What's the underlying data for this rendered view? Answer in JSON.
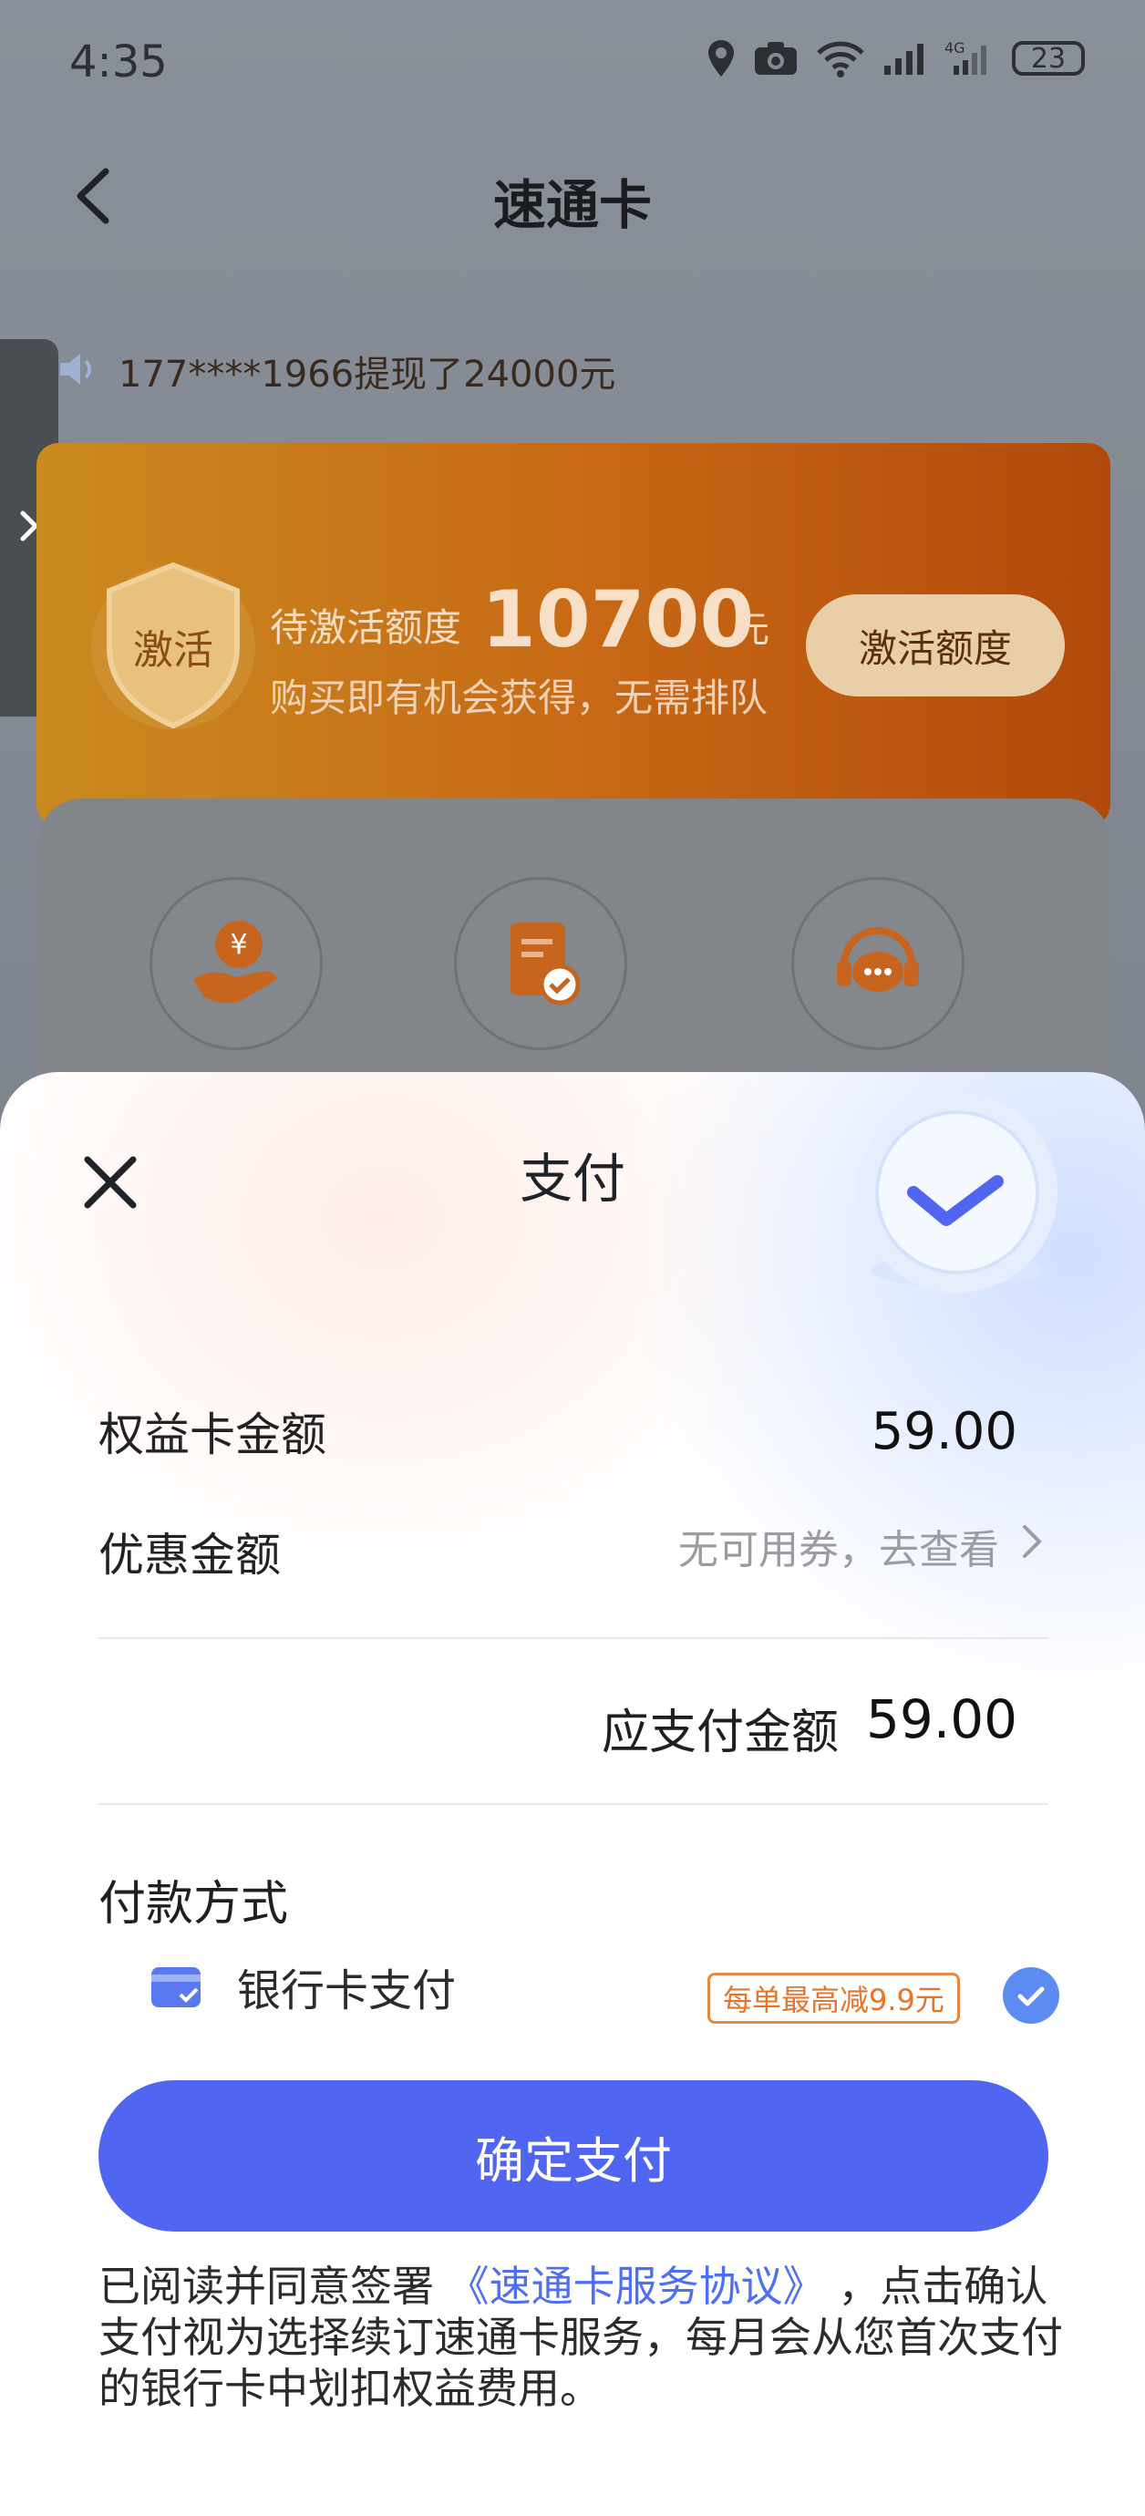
{
  "status_bar": {
    "time": "4:35",
    "battery": "23"
  },
  "header": {
    "title": "速通卡"
  },
  "ticker": {
    "text": "177****1966提现了24000元"
  },
  "promo": {
    "badge": "激活",
    "label": "待激活额度",
    "amount": "10700",
    "unit": "元",
    "subtitle": "购买即有机会获得，无需排队",
    "button": "激活额度"
  },
  "sheet": {
    "title": "支付",
    "card_amount_label": "权益卡金额",
    "card_amount_value": "59.00",
    "discount_label": "优惠金额",
    "discount_hint": "无可用券，去查看",
    "total_label": "应支付金额",
    "total_value": "59.00",
    "payment_method_title": "付款方式",
    "payment_option": {
      "label": "银行卡支付",
      "tag": "每单最高减9.9元",
      "selected": true
    },
    "confirm_button": "确定支付",
    "agreement": {
      "prefix": "已阅读并同意签署",
      "link": "《速通卡服务协议》",
      "suffix": "，点击确认支付视为选择续订速通卡服务，每月会从您首次支付的银行卡中划扣权益费用。"
    }
  },
  "colors": {
    "primary": "#5066f0",
    "promo_orange": "#c86a16",
    "tag_orange": "#e5752a",
    "link": "#4f6ff2"
  }
}
